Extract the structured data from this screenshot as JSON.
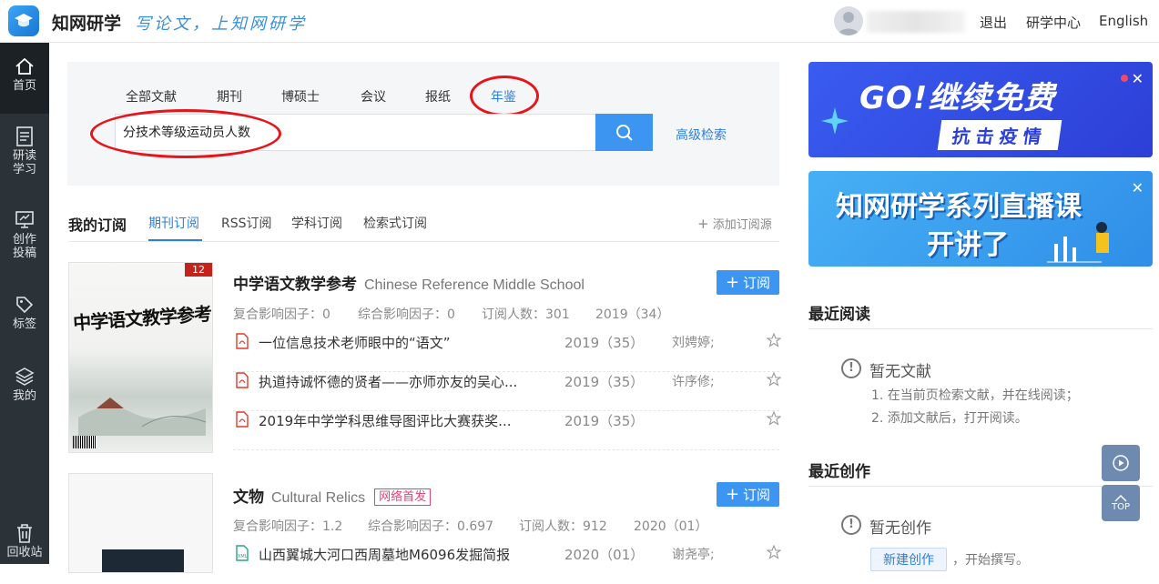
{
  "header": {
    "brand": "知网研学",
    "slogan": "写论文，上知网研学",
    "links": [
      "退出",
      "研学中心",
      "English"
    ]
  },
  "sidebar": {
    "items": [
      {
        "label": "首页",
        "icon": "home-icon"
      },
      {
        "label": "研读\n学习",
        "icon": "document-icon"
      },
      {
        "label": "创作\n投稿",
        "icon": "monitor-icon"
      },
      {
        "label": "标签",
        "icon": "tag-icon"
      },
      {
        "label": "我的",
        "icon": "layers-icon"
      },
      {
        "label": "回收站",
        "icon": "trash-icon"
      }
    ]
  },
  "search": {
    "tabs": [
      "全部文献",
      "期刊",
      "博硕士",
      "会议",
      "报纸",
      "年鉴"
    ],
    "active_tab": "年鉴",
    "query": "分技术等级运动员人数",
    "advanced_label": "高级检索"
  },
  "subscriptions": {
    "title": "我的订阅",
    "tabs": [
      "期刊订阅",
      "RSS订阅",
      "学科订阅",
      "检索式订阅"
    ],
    "add_label": "添加订阅源",
    "subscribe_label": "订阅"
  },
  "journals": [
    {
      "title": "中学语文教学参考",
      "en": "Chinese Reference Middle School",
      "cover_issue": "12",
      "cover_title": "中学语文教学参考",
      "metrics": [
        "复合影响因子：0",
        "综合影响因子：0",
        "订阅人数：301",
        "2019（34）"
      ],
      "articles": [
        {
          "title": "一位信息技术老师眼中的“语文”",
          "year": "2019（35）",
          "author": "刘娉婷;"
        },
        {
          "title": "执道持诚怀德的贤者——亦师亦友的吴心...",
          "year": "2019（35）",
          "author": "许序修;"
        },
        {
          "title": "2019年中学学科思维导图评比大赛获奖...",
          "year": "2019（35）",
          "author": ""
        }
      ]
    },
    {
      "title": "文物",
      "en": "Cultural Relics",
      "badge": "网络首发",
      "metrics": [
        "复合影响因子：1.2",
        "综合影响因子：0.697",
        "订阅人数：912",
        "2020（01）"
      ],
      "articles": [
        {
          "title": "山西翼城大河口西周墓地M6096发掘简报",
          "year": "2020（01）",
          "author": "谢尧亭;"
        }
      ]
    }
  ],
  "banners": [
    {
      "line1": "GO!继续免费",
      "line2": "抗击疫情",
      "color": "#3153e6"
    },
    {
      "line1": "知网研学系列直播课",
      "line2": "开讲了",
      "color": "#3a9bf0"
    }
  ],
  "recent_reading": {
    "title": "最近阅读",
    "empty": "暂无文献",
    "tips": [
      "1. 在当前页检索文献，并在线阅读；",
      "2. 添加文献后，打开阅读。"
    ]
  },
  "recent_creation": {
    "title": "最近创作",
    "empty": "暂无创作",
    "new_button": "新建创作",
    "tip": "，开始撰写。"
  },
  "float": {
    "top_label": "TOP"
  },
  "colors": {
    "accent": "#3c95f0",
    "sidebar": "#2b3238",
    "annotation": "#e4161c",
    "badge": "#e0457c"
  }
}
